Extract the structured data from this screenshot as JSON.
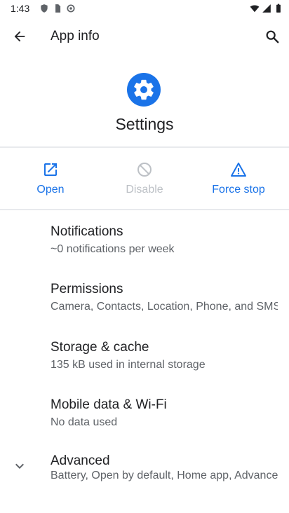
{
  "status_bar": {
    "time": "1:43",
    "left_icons": [
      "shield-icon",
      "sim-card-icon",
      "sync-icon"
    ],
    "right_icons": [
      "wifi-icon",
      "cellular-signal-icon",
      "battery-icon"
    ]
  },
  "app_bar": {
    "title": "App info",
    "back_icon": "arrow-back-icon",
    "search_icon": "search-icon"
  },
  "app": {
    "name": "Settings",
    "icon": "gear-icon",
    "icon_color": "#1a73e8"
  },
  "actions": {
    "open": {
      "label": "Open",
      "icon": "open-in-new-icon"
    },
    "disable": {
      "label": "Disable",
      "icon": "block-icon",
      "enabled": false
    },
    "force_stop": {
      "label": "Force stop",
      "icon": "warning-icon"
    }
  },
  "list": {
    "notifications": {
      "title": "Notifications",
      "subtitle": "~0 notifications per week"
    },
    "permissions": {
      "title": "Permissions",
      "subtitle": "Camera, Contacts, Location, Phone, and SMS"
    },
    "storage": {
      "title": "Storage & cache",
      "subtitle": "135 kB used in internal storage"
    },
    "mobile_data": {
      "title": "Mobile data & Wi-Fi",
      "subtitle": "No data used"
    },
    "advanced": {
      "title": "Advanced",
      "subtitle": "Battery, Open by default, Home app, Advanced",
      "icon": "chevron-down-icon"
    }
  },
  "colors": {
    "accent": "#1a73e8",
    "disabled": "#bdc1c6",
    "text_primary": "#202124",
    "text_secondary": "#5f6368"
  }
}
